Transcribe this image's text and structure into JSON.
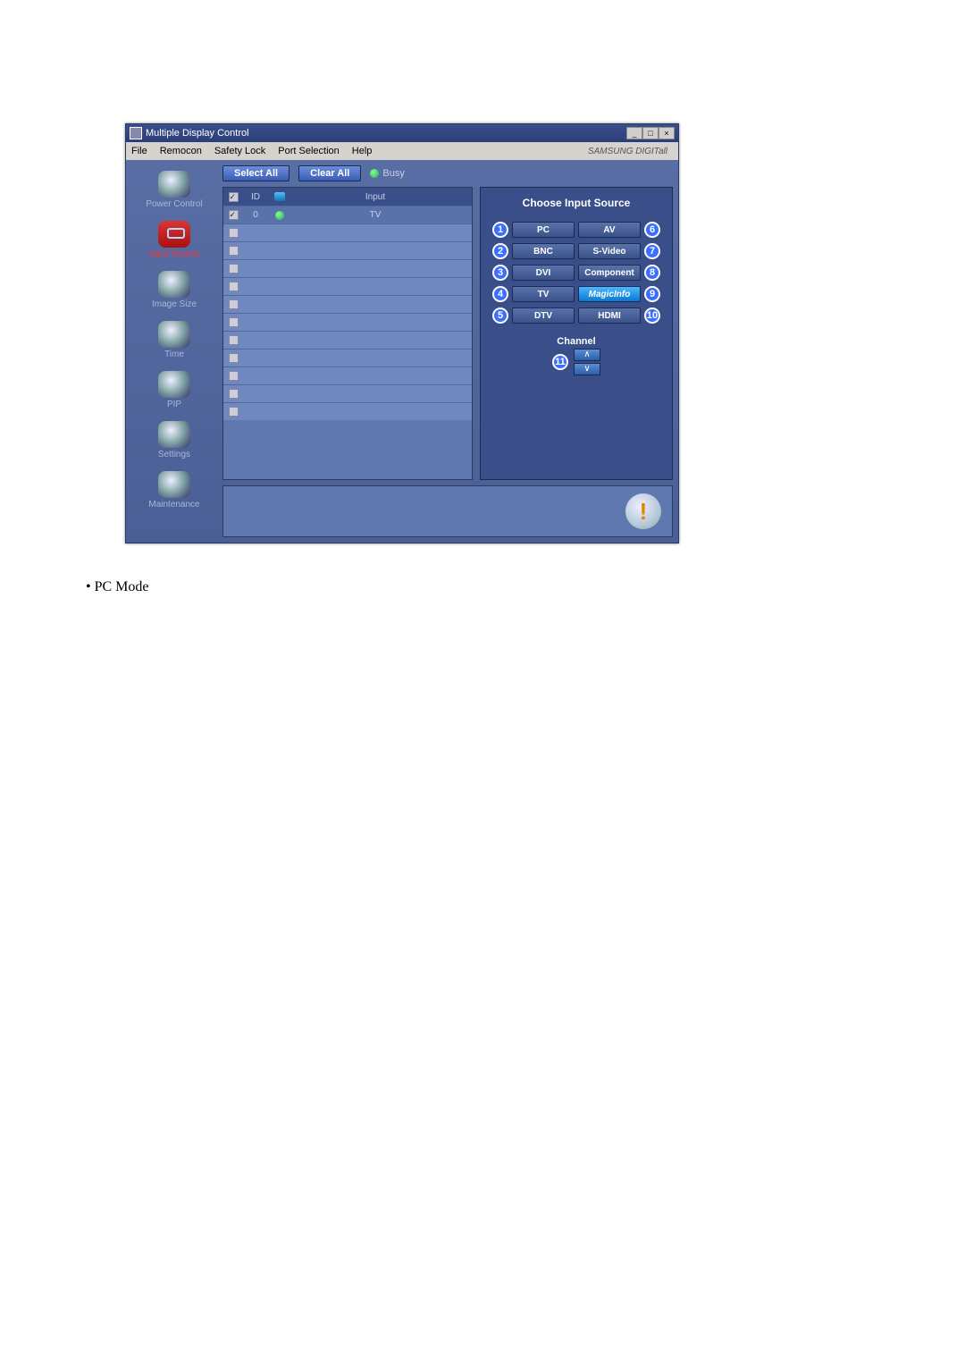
{
  "window": {
    "title": "Multiple Display Control"
  },
  "menubar": {
    "items": [
      "File",
      "Remocon",
      "Safety Lock",
      "Port Selection",
      "Help"
    ],
    "brand": "SAMSUNG DIGITall"
  },
  "sidebar": {
    "items": [
      {
        "label": "Power Control"
      },
      {
        "label": "Input Source",
        "selected": true
      },
      {
        "label": "Image Size"
      },
      {
        "label": "Time"
      },
      {
        "label": "PIP"
      },
      {
        "label": "Settings"
      },
      {
        "label": "Maintenance"
      }
    ]
  },
  "toolbar": {
    "select_all": "Select All",
    "clear_all": "Clear All",
    "busy_label": "Busy"
  },
  "grid": {
    "headers": {
      "id": "ID",
      "input": "Input"
    },
    "rows": [
      {
        "checked": true,
        "id": "0",
        "status": "on",
        "input": "TV"
      },
      {
        "checked": false,
        "id": "",
        "status": "",
        "input": ""
      },
      {
        "checked": false,
        "id": "",
        "status": "",
        "input": ""
      },
      {
        "checked": false,
        "id": "",
        "status": "",
        "input": ""
      },
      {
        "checked": false,
        "id": "",
        "status": "",
        "input": ""
      },
      {
        "checked": false,
        "id": "",
        "status": "",
        "input": ""
      },
      {
        "checked": false,
        "id": "",
        "status": "",
        "input": ""
      },
      {
        "checked": false,
        "id": "",
        "status": "",
        "input": ""
      },
      {
        "checked": false,
        "id": "",
        "status": "",
        "input": ""
      },
      {
        "checked": false,
        "id": "",
        "status": "",
        "input": ""
      },
      {
        "checked": false,
        "id": "",
        "status": "",
        "input": ""
      },
      {
        "checked": false,
        "id": "",
        "status": "",
        "input": ""
      }
    ]
  },
  "panel": {
    "title": "Choose Input Source",
    "sources": {
      "left": [
        {
          "callout": "1",
          "label": "PC"
        },
        {
          "callout": "2",
          "label": "BNC"
        },
        {
          "callout": "3",
          "label": "DVI"
        },
        {
          "callout": "4",
          "label": "TV"
        },
        {
          "callout": "5",
          "label": "DTV"
        }
      ],
      "right": [
        {
          "callout": "6",
          "label": "AV"
        },
        {
          "callout": "7",
          "label": "S-Video"
        },
        {
          "callout": "8",
          "label": "Component"
        },
        {
          "callout": "9",
          "label": "MagicInfo",
          "magic": true
        },
        {
          "callout": "10",
          "label": "HDMI"
        }
      ]
    },
    "channel": {
      "label": "Channel",
      "callout": "11"
    }
  },
  "doc": {
    "bullet": "• PC Mode"
  },
  "colors": {
    "accent_blue": "#3a6fff",
    "panel_bg": "#3a4f8a",
    "selected_red": "#ff3030"
  }
}
